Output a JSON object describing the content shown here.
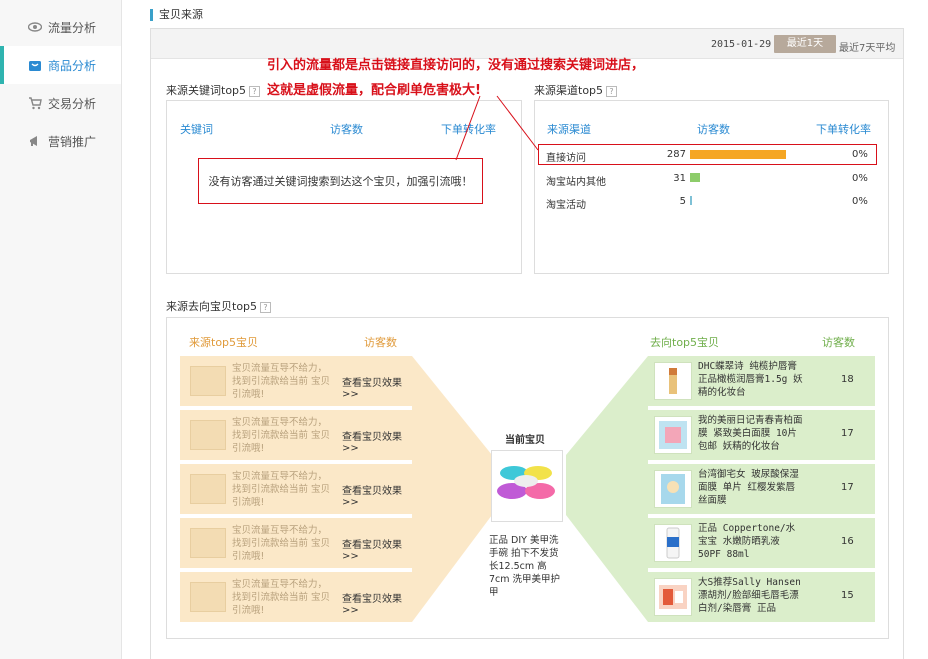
{
  "sidebar": {
    "items": [
      {
        "label": "流量分析",
        "icon": "eye-icon"
      },
      {
        "label": "商品分析",
        "icon": "bag-icon",
        "active": true
      },
      {
        "label": "交易分析",
        "icon": "cart-icon"
      },
      {
        "label": "营销推广",
        "icon": "megaphone-icon"
      }
    ]
  },
  "header": {
    "section_title": "宝贝来源",
    "date": "2015-01-29",
    "recent_btn": "最近1天",
    "avg_btn": "最近7天平均"
  },
  "annotation": {
    "line1": "引入的流量都是点击链接直接访问的，没有通过搜索关键词进店，",
    "line2": "这就是虚假流量，配合刷单危害极大!",
    "keyword_note": "没有访客通过关键词搜索到达这个宝贝，加强引流哦！"
  },
  "keywords": {
    "title": "来源关键词top5",
    "help": "?",
    "columns": [
      "关键词",
      "访客数",
      "下单转化率"
    ]
  },
  "channels": {
    "title": "来源渠道top5",
    "help": "?",
    "columns": [
      "来源渠道",
      "访客数",
      "下单转化率"
    ],
    "rows": [
      {
        "name": "直接访问",
        "visitors": 287,
        "rate": "0%"
      },
      {
        "name": "淘宝站内其他",
        "visitors": 31,
        "rate": "0%"
      },
      {
        "name": "淘宝活动",
        "visitors": 5,
        "rate": "0%"
      }
    ],
    "bar_color": "#f5a623",
    "bar_color_small": "#8dcc6a",
    "bar_color_tiny": "#7fc1d6"
  },
  "flow": {
    "title": "来源去向宝贝top5",
    "help": "?",
    "left_header": "来源top5宝贝",
    "left_visitors_header": "访客数",
    "right_header": "去向top5宝贝",
    "right_visitors_header": "访客数",
    "current_label": "当前宝贝",
    "current_desc": "正品 DIY 美甲洗手碗 拍下不发货 长12.5cm 高7cm 洗甲美甲护甲",
    "left_items": [
      {
        "text": "宝贝流量互导不给力，找到引流款给当前 宝贝引流哦!",
        "link": "查看宝贝效果>>"
      },
      {
        "text": "宝贝流量互导不给力，找到引流款给当前 宝贝引流哦!",
        "link": "查看宝贝效果>>"
      },
      {
        "text": "宝贝流量互导不给力，找到引流款给当前 宝贝引流哦!",
        "link": "查看宝贝效果>>"
      },
      {
        "text": "宝贝流量互导不给力，找到引流款给当前 宝贝引流哦!",
        "link": "查看宝贝效果>>"
      },
      {
        "text": "宝贝流量互导不给力，找到引流款给当前 宝贝引流哦!",
        "link": "查看宝贝效果>>"
      }
    ],
    "right_items": [
      {
        "text": "DHC蝶翠诗 纯榄护唇膏 正品橄榄润唇膏1.5g 妖精的化妆台",
        "count": "18"
      },
      {
        "text": "我的美丽日记青春青柏面膜 紧致美白面膜 10片包邮 妖精的化妆台",
        "count": "17"
      },
      {
        "text": "台湾御宅女 玻尿酸保湿面膜 单片 红樱发紫唇丝面膜",
        "count": "17"
      },
      {
        "text": "正品 Coppertone/水宝宝 水嫩防晒乳液 50PF 88ml",
        "count": "16"
      },
      {
        "text": "大S推荐Sally Hansen漂胡剂/脸部细毛唇毛漂白剂/染唇膏 正品",
        "count": "15"
      }
    ]
  }
}
